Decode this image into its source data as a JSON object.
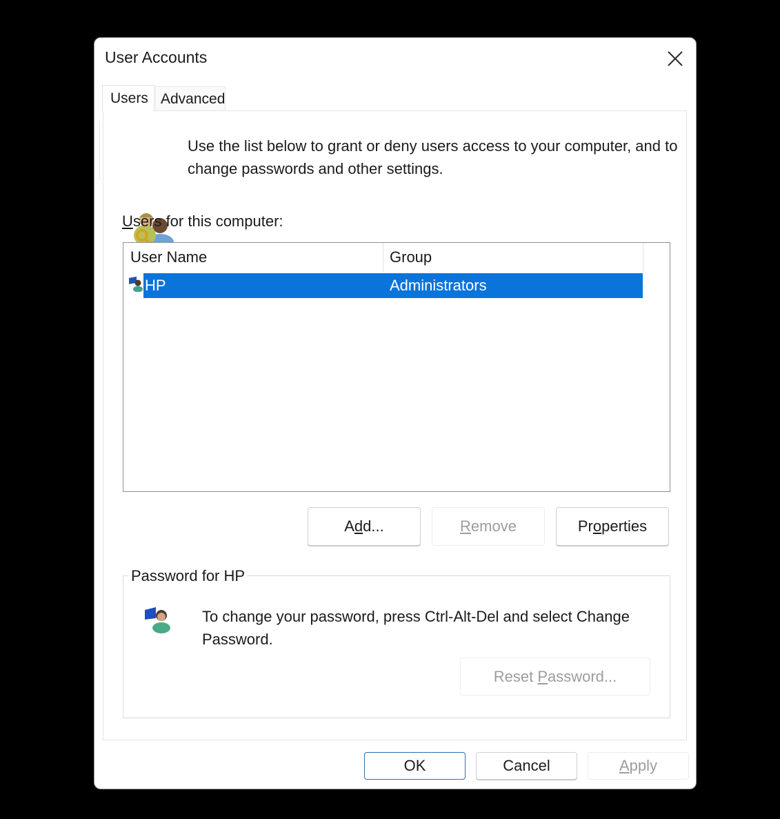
{
  "window": {
    "title": "User Accounts",
    "close_icon": "close-x-icon"
  },
  "tabs": [
    {
      "label": "Users",
      "active": true
    },
    {
      "label": "Advanced",
      "active": false
    }
  ],
  "intro": {
    "icon": "users-with-key-icon",
    "text": "Use the list below to grant or deny users access to your computer, and to change passwords and other settings."
  },
  "users_list": {
    "label_accel": "U",
    "label_rest": "sers for this computer:",
    "columns": [
      "User Name",
      "Group"
    ],
    "rows": [
      {
        "icon": "user-computer-icon",
        "user_name": "HP",
        "group": "Administrators",
        "selected": true
      }
    ],
    "selection_color": "#0a74da"
  },
  "list_buttons": {
    "add": {
      "pre": "A",
      "accel": "d",
      "post": "d...",
      "enabled": true
    },
    "remove": {
      "pre": "",
      "accel": "R",
      "post": "emove",
      "enabled": false
    },
    "properties": {
      "pre": "Pr",
      "accel": "o",
      "post": "perties",
      "enabled": true
    }
  },
  "password_group": {
    "legend": "Password for HP",
    "icon": "user-computer-icon",
    "text": "To change your password, press Ctrl-Alt-Del and select Change Password.",
    "reset_button": {
      "pre": "Reset ",
      "accel": "P",
      "post": "assword...",
      "enabled": false
    }
  },
  "footer_buttons": {
    "ok": {
      "label": "OK",
      "default": true
    },
    "cancel": {
      "label": "Cancel"
    },
    "apply": {
      "accel": "A",
      "post": "pply",
      "enabled": false
    }
  }
}
